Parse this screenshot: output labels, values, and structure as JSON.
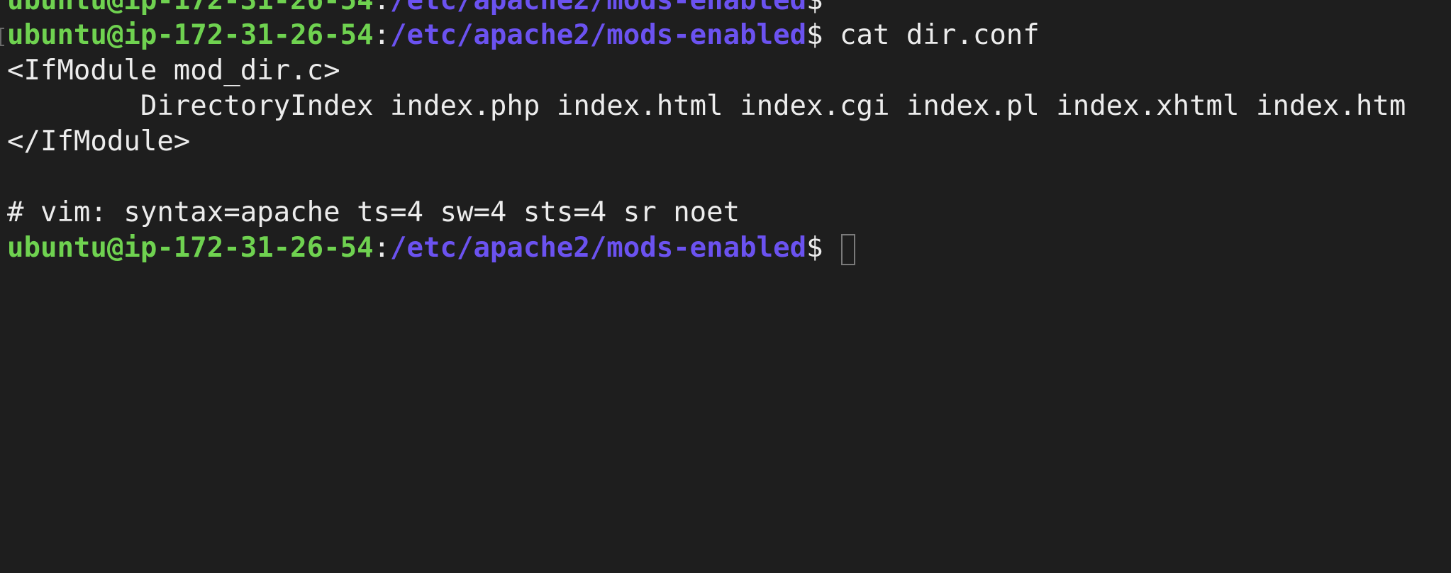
{
  "terminal": {
    "prompt": {
      "user_host": "ubuntu@ip-172-31-26-54",
      "separator": ":",
      "path": "/etc/apache2/mods-enabled",
      "symbol": "$"
    },
    "lines": [
      {
        "type": "prompt",
        "command": ""
      },
      {
        "type": "prompt",
        "command": " cat dir.conf"
      },
      {
        "type": "output",
        "text": "<IfModule mod_dir.c>"
      },
      {
        "type": "output",
        "text": "        DirectoryIndex index.php index.html index.cgi index.pl index.xhtml index.htm"
      },
      {
        "type": "output",
        "text": "</IfModule>"
      },
      {
        "type": "output",
        "text": ""
      },
      {
        "type": "output",
        "text": "# vim: syntax=apache ts=4 sw=4 sts=4 sr noet"
      },
      {
        "type": "prompt",
        "command": " "
      }
    ],
    "colors": {
      "background": "#1e1e1e",
      "text": "#ececec",
      "user_host": "#6fd250",
      "path": "#6b52f0"
    }
  }
}
